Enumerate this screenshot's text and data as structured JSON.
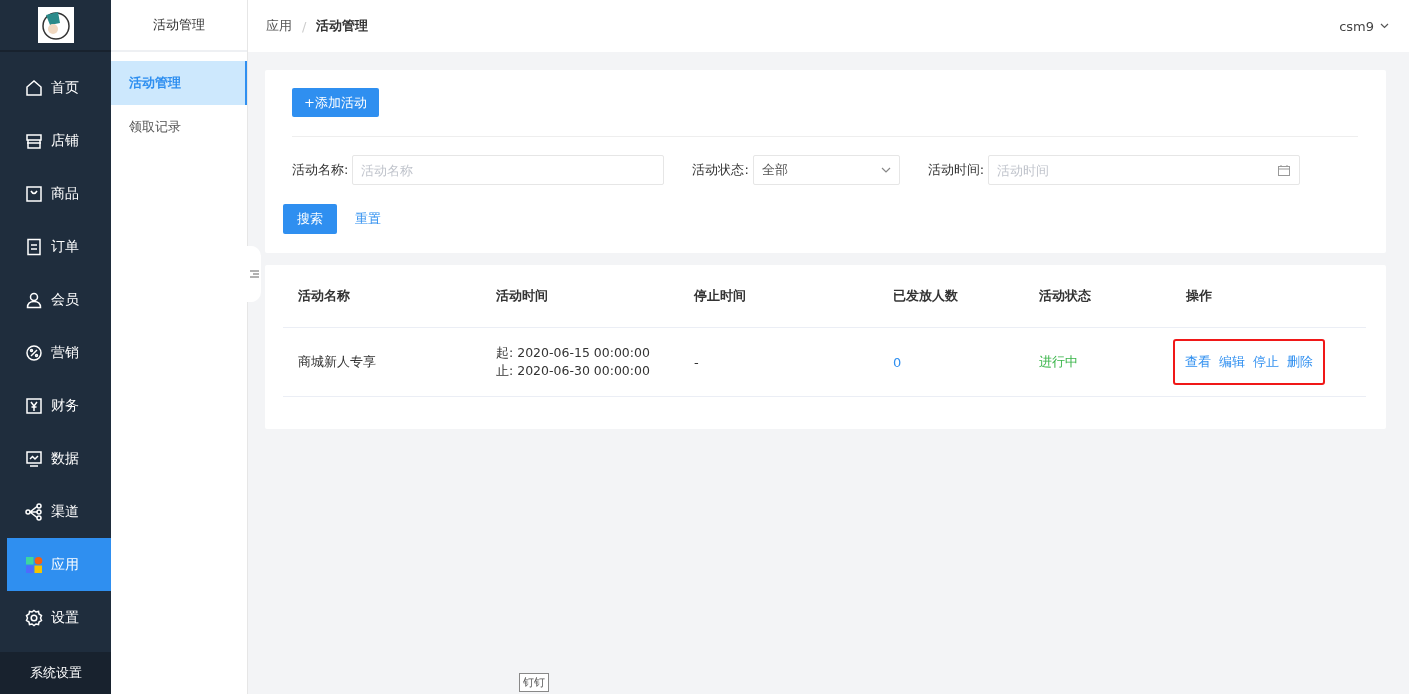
{
  "sidebar": {
    "items": [
      {
        "label": "首页",
        "kind": "home",
        "selected": false
      },
      {
        "label": "店铺",
        "kind": "shop",
        "selected": false
      },
      {
        "label": "商品",
        "kind": "bag",
        "selected": false
      },
      {
        "label": "订单",
        "kind": "order",
        "selected": false
      },
      {
        "label": "会员",
        "kind": "user",
        "selected": false
      },
      {
        "label": "营销",
        "kind": "percent",
        "selected": false
      },
      {
        "label": "财务",
        "kind": "yen",
        "selected": false
      },
      {
        "label": "数据",
        "kind": "monitor",
        "selected": false
      },
      {
        "label": "渠道",
        "kind": "share",
        "selected": false
      },
      {
        "label": "应用",
        "kind": "apps",
        "selected": true
      },
      {
        "label": "设置",
        "kind": "gear",
        "selected": false
      }
    ],
    "footer": "系统设置"
  },
  "subnav": {
    "title": "活动管理",
    "items": [
      {
        "label": "活动管理",
        "selected": true
      },
      {
        "label": "领取记录",
        "selected": false
      }
    ]
  },
  "header": {
    "breadcrumb": [
      "应用",
      "活动管理"
    ],
    "separator": "/",
    "user": "csm9"
  },
  "toolbar": {
    "add_button": "+添加活动"
  },
  "filters": {
    "name_label": "活动名称:",
    "name_placeholder": "活动名称",
    "status_label": "活动状态:",
    "status_value": "全部",
    "time_label": "活动时间:",
    "time_placeholder": "活动时间",
    "search_button": "搜索",
    "reset_link": "重置"
  },
  "table": {
    "columns": [
      "活动名称",
      "活动时间",
      "停止时间",
      "已发放人数",
      "活动状态",
      "操作"
    ],
    "rows": [
      {
        "name": "商城新人专享",
        "start": "起:  2020-06-15 00:00:00",
        "end": "止:  2020-06-30 00:00:00",
        "stop": "-",
        "count": "0",
        "status": "进行中",
        "actions": [
          "查看",
          "编辑",
          "停止",
          "删除"
        ]
      }
    ]
  },
  "tooltip": "钉钉"
}
